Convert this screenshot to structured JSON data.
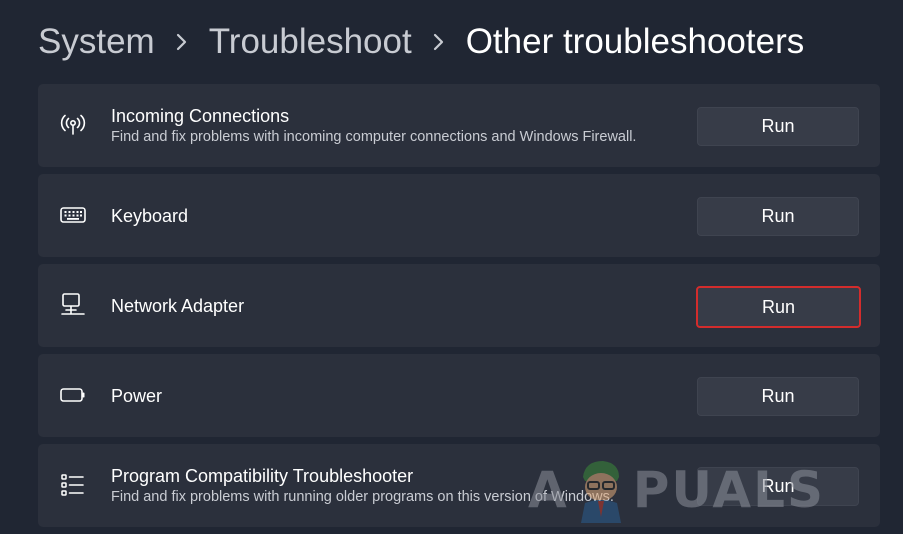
{
  "breadcrumb": {
    "items": [
      "System",
      "Troubleshoot",
      "Other troubleshooters"
    ]
  },
  "troubleshooters": [
    {
      "icon": "broadcast-icon",
      "title": "Incoming Connections",
      "description": "Find and fix problems with incoming computer connections and Windows Firewall.",
      "button": "Run"
    },
    {
      "icon": "keyboard-icon",
      "title": "Keyboard",
      "description": "",
      "button": "Run"
    },
    {
      "icon": "network-adapter-icon",
      "title": "Network Adapter",
      "description": "",
      "button": "Run",
      "highlighted": true
    },
    {
      "icon": "battery-icon",
      "title": "Power",
      "description": "",
      "button": "Run"
    },
    {
      "icon": "checklist-icon",
      "title": "Program Compatibility Troubleshooter",
      "description": "Find and fix problems with running older programs on this version of Windows.",
      "button": "Run"
    }
  ],
  "watermark": {
    "text_left": "A",
    "text_right": "PUALS"
  },
  "colors": {
    "background": "#202633",
    "card": "#2b303c",
    "button": "#373c48",
    "highlight_border": "#d32c2c",
    "text_primary": "#ffffff",
    "text_secondary": "#c9ccd3"
  }
}
